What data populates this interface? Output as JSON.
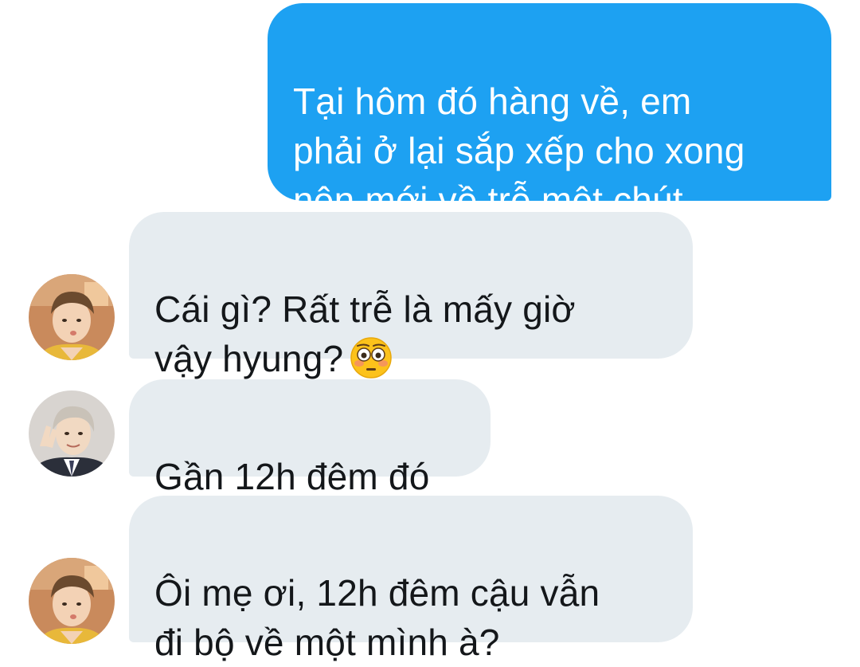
{
  "conversation": {
    "messages": [
      {
        "direction": "outgoing",
        "text": "Tại hôm đó hàng về, em\nphải ở lại sắp xếp cho xong\nnên mới về trễ một chút"
      },
      {
        "direction": "incoming",
        "sender_avatar": "avatar-brown-hair-person",
        "text": "Cái gì? Rất trễ là mấy giờ\nvậy hyung?",
        "emoji": "flushed-face-emoji"
      },
      {
        "direction": "incoming",
        "sender_avatar": "avatar-silver-hair-person",
        "text": "Gần 12h đêm đó"
      },
      {
        "direction": "incoming",
        "sender_avatar": "avatar-brown-hair-person",
        "text": "Ôi mẹ ơi, 12h đêm cậu vẫn\nđi bộ về một mình à?"
      }
    ]
  },
  "colors": {
    "outgoing_bubble": "#1da1f2",
    "incoming_bubble": "#e6ecf0",
    "incoming_text": "#14171a",
    "outgoing_text": "#ffffff"
  }
}
